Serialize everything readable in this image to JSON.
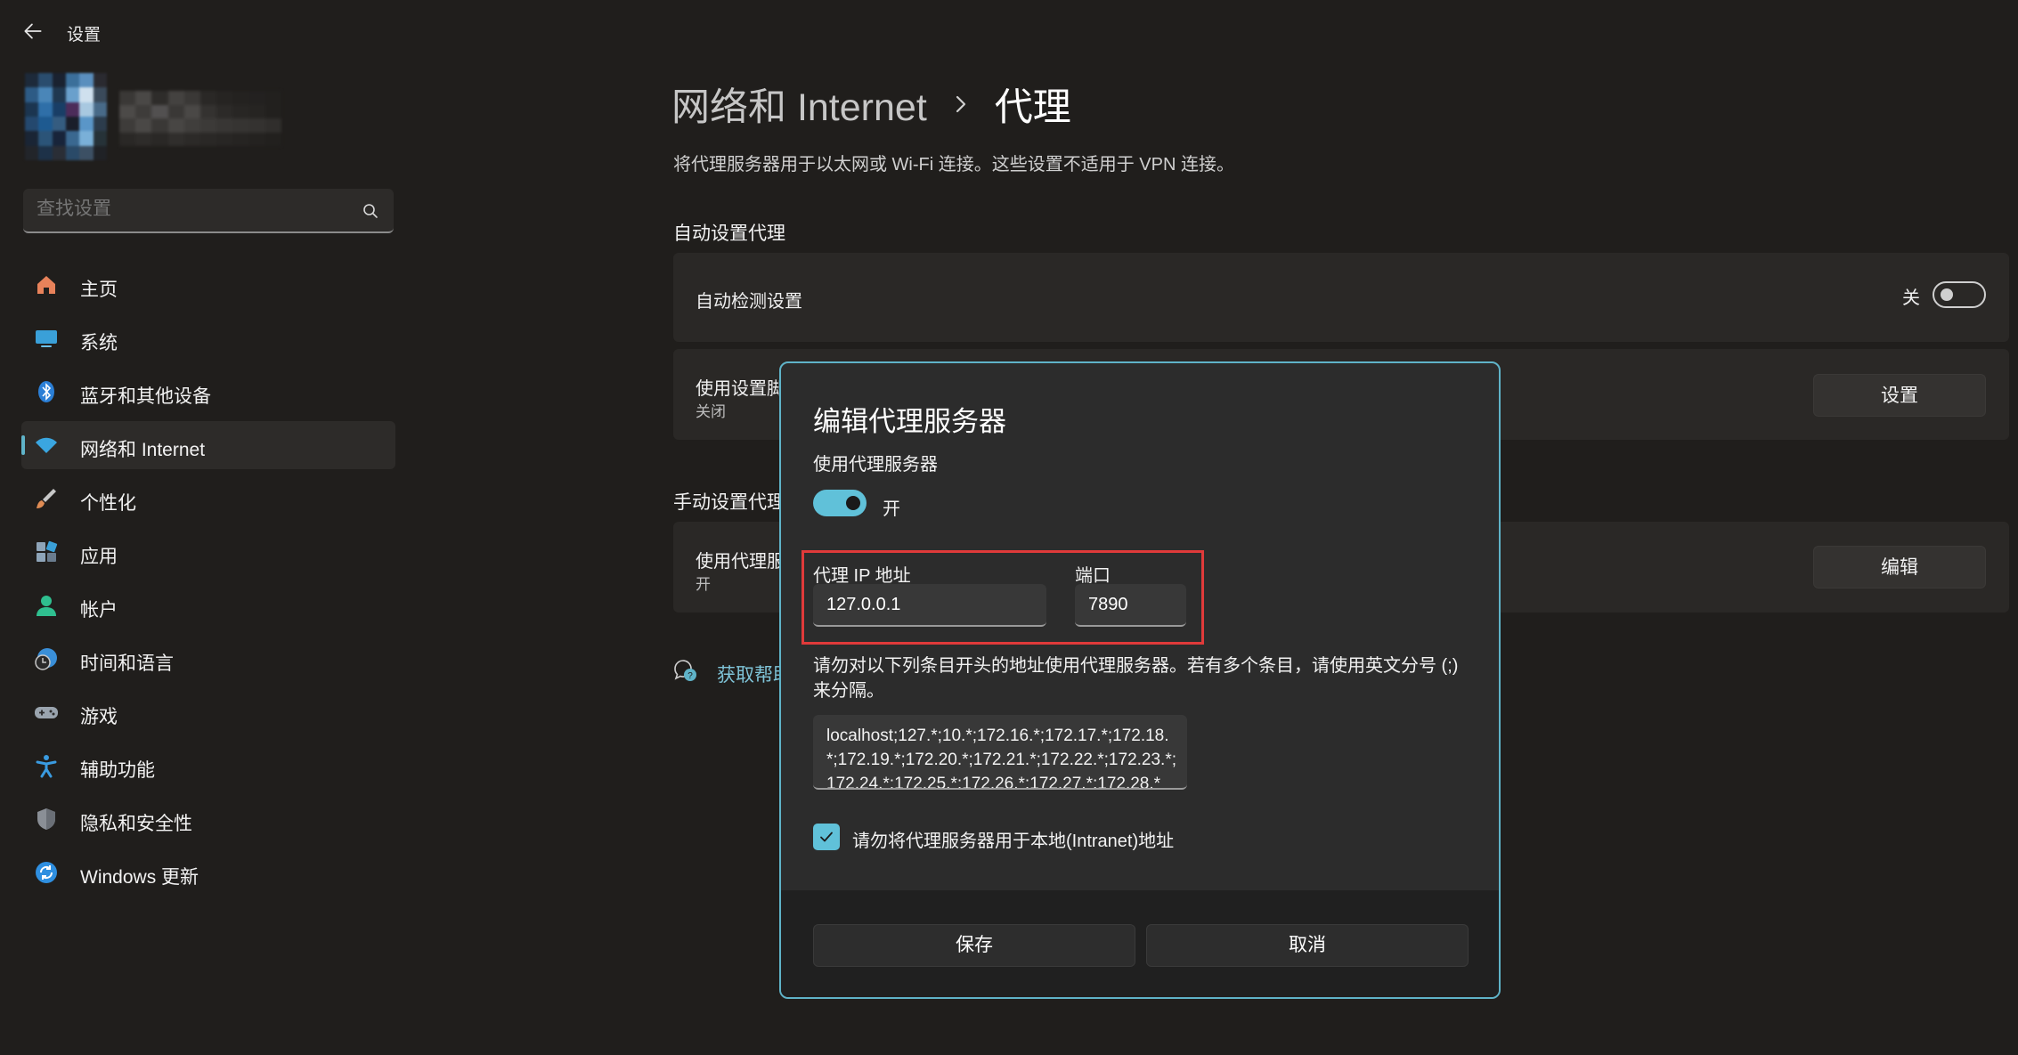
{
  "titlebar": {
    "title": "设置",
    "back_icon": "back-arrow-icon"
  },
  "search": {
    "placeholder": "查找设置",
    "icon": "search-icon"
  },
  "nav": {
    "items": [
      {
        "label": "主页",
        "icon": "home-icon",
        "color": "#e8825a"
      },
      {
        "label": "系统",
        "icon": "system-display-icon",
        "color": "#3aa0d8"
      },
      {
        "label": "蓝牙和其他设备",
        "icon": "bluetooth-icon",
        "color": "#2b7fd6"
      },
      {
        "label": "网络和 Internet",
        "icon": "wifi-icon",
        "color": "#3aa6e0",
        "selected": true
      },
      {
        "label": "个性化",
        "icon": "brush-icon",
        "color": "#e08c54"
      },
      {
        "label": "应用",
        "icon": "apps-icon",
        "color": "#8ea4b8"
      },
      {
        "label": "帐户",
        "icon": "account-icon",
        "color": "#2fbf8f"
      },
      {
        "label": "时间和语言",
        "icon": "time-language-icon",
        "color": "#3a8fd8"
      },
      {
        "label": "游戏",
        "icon": "gamepad-icon",
        "color": "#9aa4ae"
      },
      {
        "label": "辅助功能",
        "icon": "accessibility-icon",
        "color": "#3a9be0"
      },
      {
        "label": "隐私和安全性",
        "icon": "shield-icon",
        "color": "#8a8f96"
      },
      {
        "label": "Windows 更新",
        "icon": "windows-update-icon",
        "color": "#2f8fe0"
      }
    ]
  },
  "header": {
    "breadcrumb_parent": "网络和 Internet",
    "breadcrumb_current": "代理",
    "description": "将代理服务器用于以太网或 Wi-Fi 连接。这些设置不适用于 VPN 连接。"
  },
  "auto_section": {
    "title": "自动设置代理",
    "detect": {
      "label": "自动检测设置",
      "state": "关",
      "on": false
    },
    "script": {
      "label": "使用设置脚",
      "sub": "关闭",
      "button": "设置"
    }
  },
  "manual_section": {
    "title": "手动设置代理",
    "proxy": {
      "label": "使用代理服",
      "sub": "开",
      "button": "编辑"
    }
  },
  "help": {
    "label": "获取帮助"
  },
  "dialog": {
    "title": "编辑代理服务器",
    "use_proxy_label": "使用代理服务器",
    "use_proxy_state": "开",
    "use_proxy_on": true,
    "ip_label": "代理 IP 地址",
    "ip_value": "127.0.0.1",
    "port_label": "端口",
    "port_value": "7890",
    "exceptions_desc": "请勿对以下列条目开头的地址使用代理服务器。若有多个条目，请使用英文分号 (;) 来分隔。",
    "exceptions_value": "localhost;127.*;10.*;172.16.*;172.17.*;172.18.*;172.19.*;172.20.*;172.21.*;172.22.*;172.23.*;172.24.*;172.25.*;172.26.*;172.27.*;172.28.*",
    "local_checkbox_label": "请勿将代理服务器用于本地(Intranet)地址",
    "local_checked": true,
    "save_label": "保存",
    "cancel_label": "取消"
  },
  "colors": {
    "accent": "#60c1d9",
    "highlight": "#e03a3a",
    "background": "#201e1c"
  }
}
